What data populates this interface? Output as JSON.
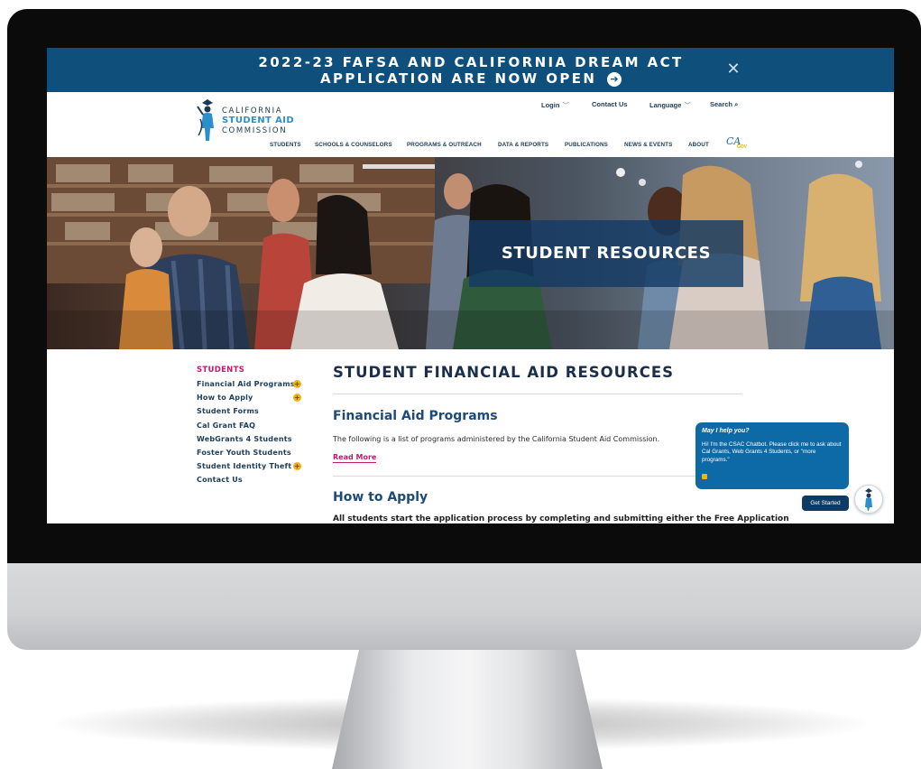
{
  "alert": {
    "text": "2022-23 FAFSA AND CALIFORNIA DREAM ACT APPLICATION ARE NOW OPEN",
    "arrow_icon": "chevron-right-circle-icon",
    "close_glyph": "✕",
    "background": "#0e4f7b"
  },
  "logo": {
    "line1": "CALIFORNIA",
    "line2": "STUDENT AID",
    "line3": "COMMISSION"
  },
  "utility_nav": {
    "login": "Login",
    "contact": "Contact Us",
    "language": "Language",
    "search": "Search",
    "chevron": "﹀",
    "search_glyph": "⌕"
  },
  "main_nav": {
    "items": [
      "STUDENTS",
      "SCHOOLS & COUNSELORS",
      "PROGRAMS & OUTREACH",
      "DATA & REPORTS",
      "PUBLICATIONS",
      "NEWS & EVENTS",
      "ABOUT"
    ],
    "ca_gov": "CA",
    "ca_gov_small": "GOV"
  },
  "hero": {
    "title": "STUDENT RESOURCES"
  },
  "sidebar": {
    "heading": "STUDENTS",
    "items": [
      {
        "label": "Financial Aid Programs",
        "expandable": true
      },
      {
        "label": "How to Apply",
        "expandable": true
      },
      {
        "label": "Student Forms",
        "expandable": false
      },
      {
        "label": "Cal Grant FAQ",
        "expandable": false
      },
      {
        "label": "WebGrants 4 Students",
        "expandable": false
      },
      {
        "label": "Foster Youth Students",
        "expandable": false
      },
      {
        "label": "Student Identity Theft",
        "expandable": true
      },
      {
        "label": "Contact Us",
        "expandable": false
      }
    ],
    "plus_glyph": "+"
  },
  "main": {
    "title": "STUDENT FINANCIAL AID RESOURCES",
    "section1_title": "Financial Aid Programs",
    "section1_body": "The following is a list of programs administered by the California Student Aid Commission.",
    "read_more": "Read More",
    "section2_title": "How to Apply",
    "section2_body": "All students start the application process by completing and submitting either the Free Application"
  },
  "chatbot": {
    "title": "May I help you?",
    "message": "Hi! I'm the CSAC Chatbot. Please click me to ask about Cal Grants, Web Grants 4 Students, or \"more programs.\"",
    "button": "Get Started",
    "accent": "#0e6aa6"
  },
  "colors": {
    "brand_navy": "#1b2f4a",
    "brand_blue": "#2c8fca",
    "accent_magenta": "#c01c6b",
    "accent_yellow": "#f3b20f"
  }
}
